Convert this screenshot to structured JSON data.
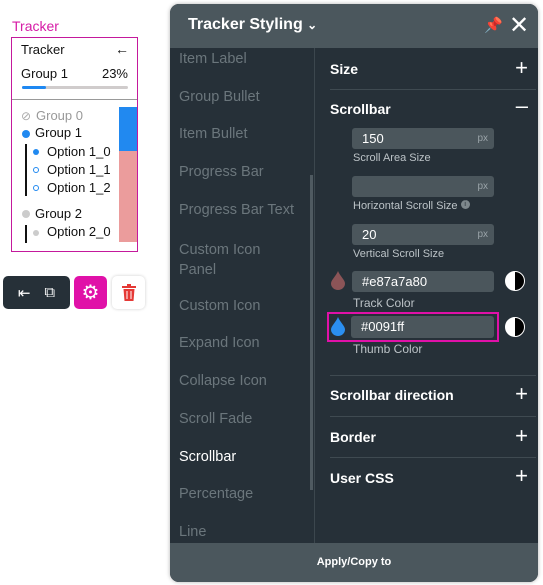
{
  "widget": {
    "label": "Tracker",
    "title": "Tracker",
    "progress_group": "Group 1",
    "progress_text": "23%",
    "progress": 23,
    "groups": [
      {
        "name": "Group 0",
        "state": "done"
      },
      {
        "name": "Group 1",
        "state": "active",
        "options": [
          "Option 1_0",
          "Option 1_1",
          "Option 1_2"
        ]
      },
      {
        "name": "Group 2",
        "state": "pending",
        "options": [
          "Option 2_0"
        ]
      }
    ]
  },
  "toolbar": {
    "icons": [
      "align-left-icon",
      "external-link-icon",
      "gear-icon",
      "trash-icon"
    ]
  },
  "panel": {
    "title": "Tracker Styling",
    "apply_label": "Apply/Copy to",
    "nav": [
      "Item Label",
      "Group Bullet",
      "Item Bullet",
      "Progress Bar",
      "Progress Bar Text",
      "Custom Icon Panel",
      "Custom Icon",
      "Expand Icon",
      "Collapse Icon",
      "Scroll Fade",
      "Scrollbar",
      "Percentage",
      "Line"
    ],
    "active_nav": "Scrollbar",
    "sections": {
      "size": "Size",
      "scrollbar": "Scrollbar",
      "direction": "Scrollbar direction",
      "border": "Border",
      "user_css": "User CSS"
    },
    "fields": {
      "scroll_area_size": {
        "value": "150",
        "unit": "px",
        "label": "Scroll Area Size"
      },
      "horizontal_scroll_size": {
        "value": "",
        "unit": "px",
        "label": "Horizontal Scroll Size"
      },
      "vertical_scroll_size": {
        "value": "20",
        "unit": "px",
        "label": "Vertical Scroll Size"
      },
      "track_color": {
        "value": "#e87a7a80",
        "label": "Track Color"
      },
      "thumb_color": {
        "value": "#0091ff",
        "label": "Thumb Color"
      }
    }
  },
  "colors": {
    "accent": "#d61ba6",
    "panel_bg": "#263038",
    "header_bg": "#4b575d"
  }
}
